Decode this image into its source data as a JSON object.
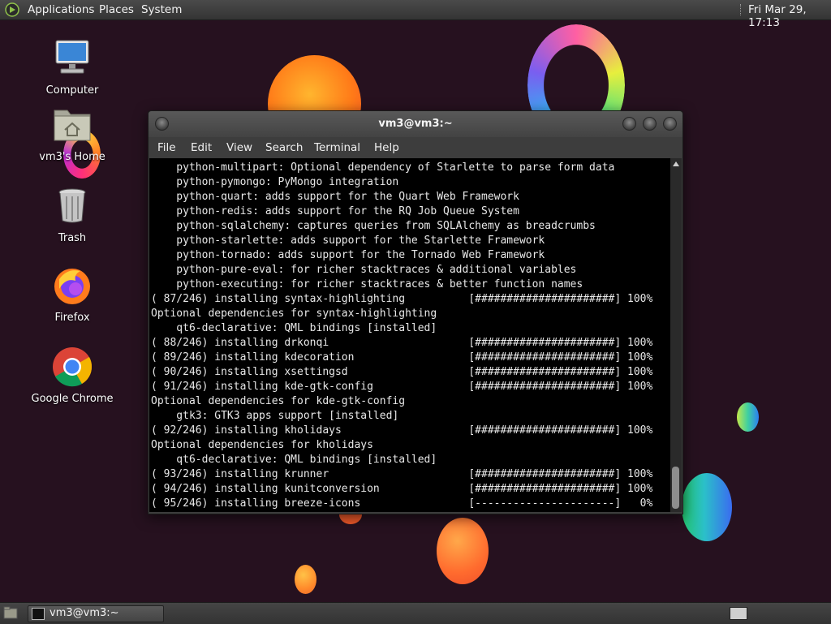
{
  "top_panel": {
    "menus": [
      "Applications",
      "Places",
      "System"
    ],
    "clock": "Fri Mar 29, 17:13"
  },
  "desktop": {
    "icons": [
      {
        "label": "Computer"
      },
      {
        "label": "vm3's Home"
      },
      {
        "label": "Trash"
      },
      {
        "label": "Firefox"
      },
      {
        "label": "Google Chrome"
      }
    ]
  },
  "window": {
    "title": "vm3@vm3:~",
    "menus": [
      "File",
      "Edit",
      "View",
      "Search",
      "Terminal",
      "Help"
    ],
    "terminal_lines": [
      "    python-multipart: Optional dependency of Starlette to parse form data",
      "    python-pymongo: PyMongo integration",
      "    python-quart: adds support for the Quart Web Framework",
      "    python-redis: adds support for the RQ Job Queue System",
      "    python-sqlalchemy: captures queries from SQLAlchemy as breadcrumbs",
      "    python-starlette: adds support for the Starlette Framework",
      "    python-tornado: adds support for the Tornado Web Framework",
      "    python-pure-eval: for richer stacktraces & additional variables",
      "    python-executing: for richer stacktraces & better function names",
      "( 87/246) installing syntax-highlighting          [######################] 100%",
      "Optional dependencies for syntax-highlighting",
      "    qt6-declarative: QML bindings [installed]",
      "( 88/246) installing drkonqi                      [######################] 100%",
      "( 89/246) installing kdecoration                  [######################] 100%",
      "( 90/246) installing xsettingsd                   [######################] 100%",
      "( 91/246) installing kde-gtk-config               [######################] 100%",
      "Optional dependencies for kde-gtk-config",
      "    gtk3: GTK3 apps support [installed]",
      "( 92/246) installing kholidays                    [######################] 100%",
      "Optional dependencies for kholidays",
      "    qt6-declarative: QML bindings [installed]",
      "( 93/246) installing krunner                      [######################] 100%",
      "( 94/246) installing kunitconversion              [######################] 100%",
      "( 95/246) installing breeze-icons                 [----------------------]   0%"
    ]
  },
  "taskbar": {
    "task_label": "vm3@vm3:~"
  }
}
